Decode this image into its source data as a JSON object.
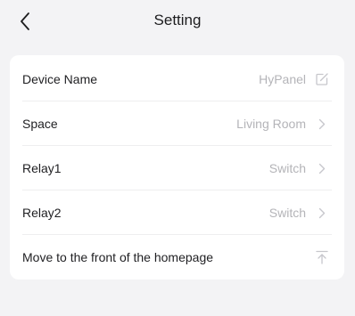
{
  "header": {
    "title": "Setting",
    "back_icon": "chevron-left-icon"
  },
  "settings": {
    "rows": [
      {
        "label": "Device Name",
        "value": "HyPanel",
        "icon": "edit-icon"
      },
      {
        "label": "Space",
        "value": "Living Room",
        "icon": "chevron-right-icon"
      },
      {
        "label": "Relay1",
        "value": "Switch",
        "icon": "chevron-right-icon"
      },
      {
        "label": "Relay2",
        "value": "Switch",
        "icon": "chevron-right-icon"
      },
      {
        "label": "Move to the front of the homepage",
        "icon": "move-to-top-icon"
      }
    ]
  },
  "colors": {
    "background": "#f3f3f5",
    "card": "#ffffff",
    "text": "#1f1f22",
    "value_text": "#b4b4b8",
    "icon": "#c7c7cc"
  }
}
